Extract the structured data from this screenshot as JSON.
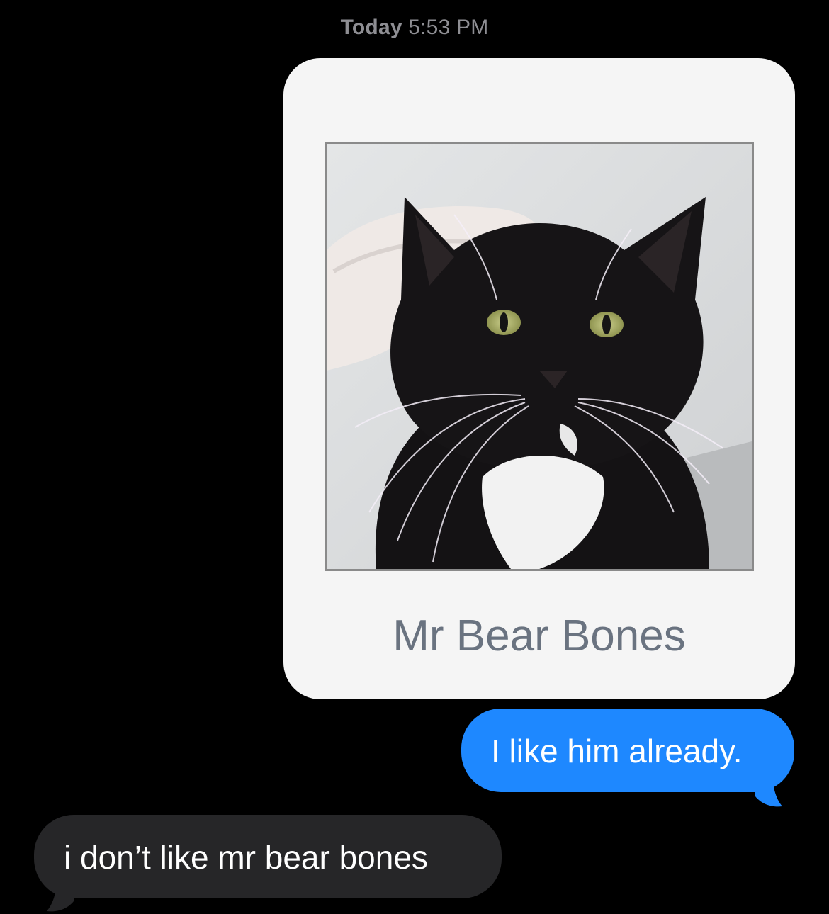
{
  "timestamp": {
    "day": "Today",
    "time": "5:53 PM"
  },
  "card": {
    "image_alt": "black and white tuxedo cat",
    "caption": "Mr Bear Bones"
  },
  "messages": [
    {
      "direction": "outgoing",
      "text": "I like him already."
    },
    {
      "direction": "incoming",
      "text": "i don’t like mr bear bones"
    }
  ],
  "colors": {
    "background": "#000000",
    "outgoing_bubble": "#1e88ff",
    "incoming_bubble": "#262628",
    "timestamp": "#8e8e93",
    "card": "#f5f5f5",
    "caption": "#6a7380"
  }
}
